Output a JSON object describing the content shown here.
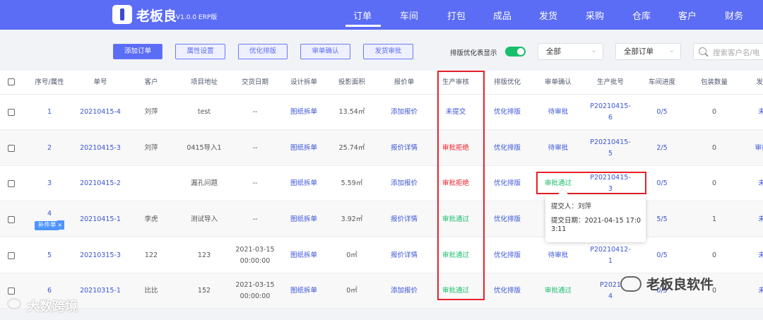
{
  "app": {
    "name": "老板良",
    "version": "V1.0.0 ERP版"
  },
  "nav": [
    "订单",
    "车间",
    "打包",
    "成品",
    "发货",
    "采购",
    "仓库",
    "客户",
    "财务"
  ],
  "toolbar": {
    "buttons": [
      "添加订单",
      "属性设置",
      "优化排版",
      "审单确认",
      "发货审批"
    ],
    "toggle_label": "排版优化表显示",
    "select1": "全部",
    "select2": "全部订单",
    "search_placeholder": "搜索客户名/电"
  },
  "table": {
    "headers": [
      "序号/属性",
      "单号",
      "客户",
      "项目地址",
      "交货日期",
      "设计拆单",
      "投影面积",
      "报价单",
      "生产审核",
      "排版优化",
      "审单确认",
      "生产批号",
      "车间进度",
      "包装数量",
      "发货"
    ],
    "rows": [
      {
        "seq": "1",
        "tag": "",
        "order": "20210415-4",
        "customer": "刘萍",
        "address": "test",
        "date": "--",
        "date2": "",
        "design": "图纸拆单",
        "area": "13.54㎡",
        "quote": "添加报价",
        "review": "未提交",
        "optimize": "优化排版",
        "confirm": "待审批",
        "batch": "P20210415-",
        "batch2": "6",
        "progress": "0/5",
        "pack": "0",
        "ship": "未"
      },
      {
        "seq": "2",
        "tag": "",
        "order": "20210415-3",
        "customer": "刘萍",
        "address": "0415导入1",
        "date": "--",
        "date2": "",
        "design": "图纸拆单",
        "area": "25.74㎡",
        "quote": "报价详情",
        "review": "审批拒绝",
        "optimize": "优化排版",
        "confirm": "待审批",
        "batch": "P20210415-",
        "batch2": "5",
        "progress": "2/5",
        "pack": "0",
        "ship": "审批"
      },
      {
        "seq": "3",
        "tag": "",
        "order": "20210415-2",
        "customer": "",
        "address": "漏孔问题",
        "date": "--",
        "date2": "",
        "design": "图纸拆单",
        "area": "5.59㎡",
        "quote": "添加报价",
        "review": "审批拒绝",
        "optimize": "优化排版",
        "confirm": "审批通过",
        "batch": "P20210415-",
        "batch2": "3",
        "progress": "0/5",
        "pack": "0",
        "ship": "未"
      },
      {
        "seq": "4",
        "tag": "补件单",
        "order": "20210415-1",
        "customer": "李虎",
        "address": "测试导入",
        "date": "--",
        "date2": "",
        "design": "图纸拆单",
        "area": "3.92㎡",
        "quote": "报价详情",
        "review": "审批通过",
        "optimize": "优化排版",
        "confirm": "",
        "batch": "",
        "batch2": "",
        "progress": "5/5",
        "pack": "1",
        "ship": "未"
      },
      {
        "seq": "5",
        "tag": "",
        "order": "20210315-3",
        "customer": "122",
        "address": "123",
        "date": "2021-03-15",
        "date2": "00:00:00",
        "design": "图纸拆单",
        "area": "0㎡",
        "quote": "报价详情",
        "review": "审批通过",
        "optimize": "优化排版",
        "confirm": "待审批",
        "batch": "P20210412-",
        "batch2": "1",
        "progress": "0/5",
        "pack": "0",
        "ship": "未"
      },
      {
        "seq": "6",
        "tag": "",
        "order": "20210315-1",
        "customer": "比比",
        "address": "152",
        "date": "2021-03-15",
        "date2": "00:00:00",
        "design": "图纸拆单",
        "area": "0㎡",
        "quote": "添加报价",
        "review": "审批通过",
        "optimize": "优化排版",
        "confirm": "审批通过",
        "batch": "P2021",
        "batch2": "4",
        "progress": "0/5",
        "pack": "0",
        "ship": "未"
      }
    ]
  },
  "tooltip": {
    "submitter": "提交人：刘萍",
    "date_line1": "提交日期：2021-04-15 17:0",
    "date_line2": "3:11"
  },
  "watermarks": {
    "left": "大数跨境",
    "right": "老板良软件"
  },
  "colors": {
    "primary": "#5b6cf5",
    "link": "#3a55d6",
    "danger": "#ed1c24",
    "success": "#19be6b",
    "highlight_box": "#e8202a"
  }
}
